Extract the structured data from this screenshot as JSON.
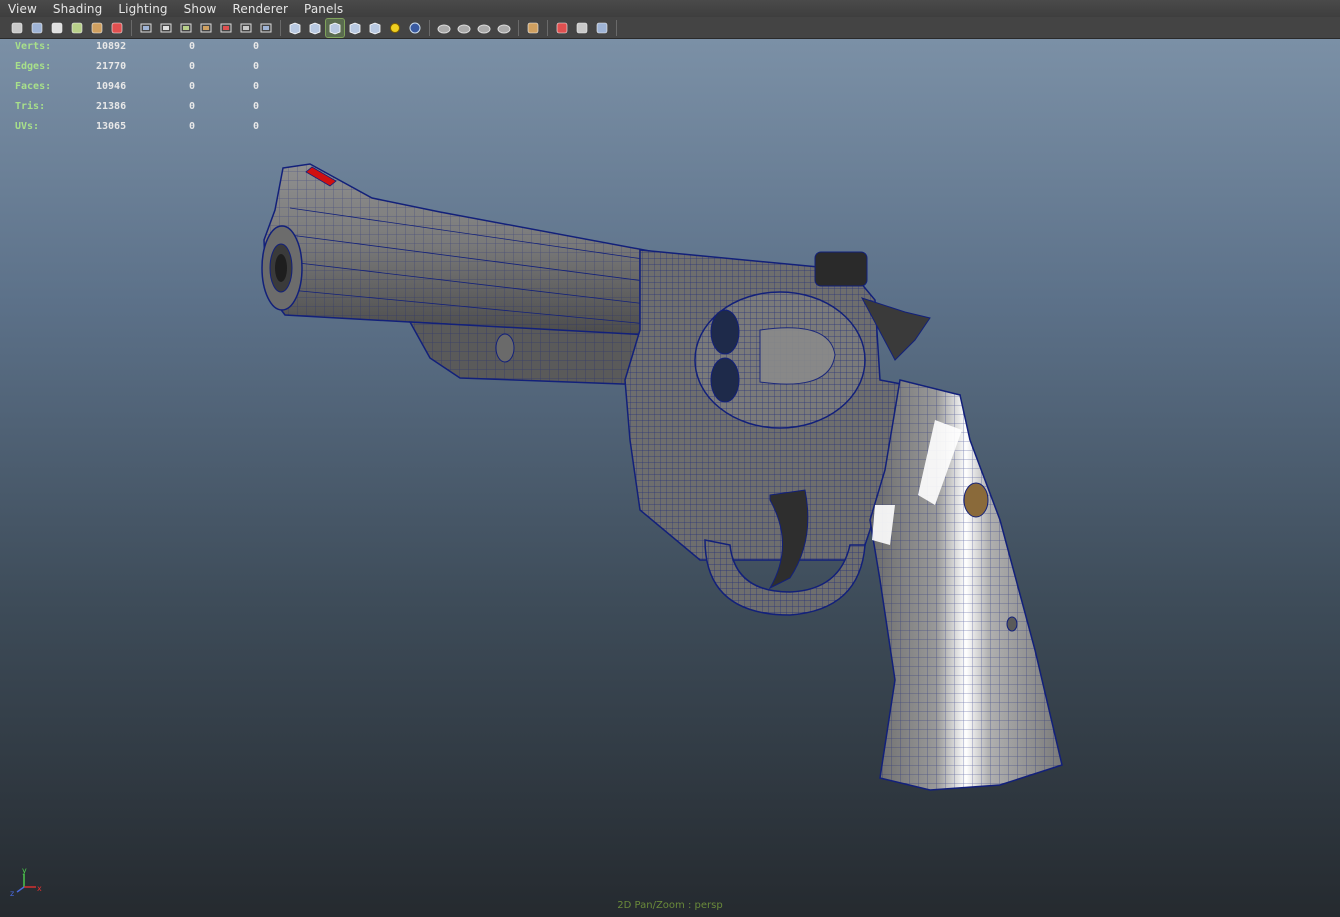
{
  "menubar": {
    "items": [
      {
        "label": "View"
      },
      {
        "label": "Shading"
      },
      {
        "label": "Lighting"
      },
      {
        "label": "Show"
      },
      {
        "label": "Renderer"
      },
      {
        "label": "Panels"
      }
    ]
  },
  "toolbar": {
    "groups": [
      [
        "camera-attributes-icon",
        "camera-bookmark-icon",
        "image-plane-icon",
        "two-d-pan-icon",
        "grease-pencil-icon",
        "unknown-red-icon"
      ],
      [
        "grid-icon",
        "film-gate-icon",
        "resolution-gate-icon",
        "gate-mask-icon",
        "field-chart-icon",
        "safe-action-icon",
        "safe-title-icon"
      ],
      [
        "wireframe-icon",
        "smooth-shade-icon",
        "wireframe-on-shaded-icon",
        "flat-shade-icon",
        "textured-icon",
        "lights-icon",
        "shadows-icon"
      ],
      [
        "ambient-occlusion-icon",
        "motion-blur-icon",
        "anti-alias-icon",
        "depth-of-field-icon"
      ],
      [
        "isolate-select-icon"
      ],
      [
        "xray-icon",
        "xray-active-icon",
        "xray-joints-icon"
      ]
    ],
    "active": "wireframe-on-shaded-icon"
  },
  "hud": {
    "rows": [
      {
        "label": "Verts:",
        "values": [
          "10892",
          "0",
          "0"
        ]
      },
      {
        "label": "Edges:",
        "values": [
          "21770",
          "0",
          "0"
        ]
      },
      {
        "label": "Faces:",
        "values": [
          "10946",
          "0",
          "0"
        ]
      },
      {
        "label": "Tris:",
        "values": [
          "21386",
          "0",
          "0"
        ]
      },
      {
        "label": "UVs:",
        "values": [
          "13065",
          "0",
          "0"
        ]
      }
    ]
  },
  "axis": {
    "y": "y",
    "x": "x",
    "z": "z"
  },
  "status": {
    "text": "2D Pan/Zoom : persp"
  },
  "colors": {
    "wire": "#12207a",
    "mesh": "#8a8a8a",
    "highlight": "#ffffff",
    "accent": "#d01010"
  }
}
